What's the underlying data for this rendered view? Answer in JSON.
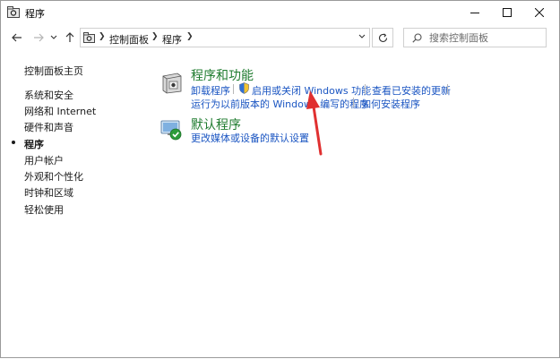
{
  "window": {
    "title": "程序",
    "minimize_icon": "minimize-icon",
    "maximize_icon": "maximize-icon",
    "close_icon": "close-icon"
  },
  "navigation": {
    "back_icon": "arrow-left-icon",
    "forward_icon": "arrow-right-icon",
    "recent_icon": "chevron-down-icon",
    "up_icon": "arrow-up-icon",
    "refresh_icon": "refresh-icon"
  },
  "address": {
    "crumbs": [
      "控制面板",
      "程序"
    ]
  },
  "search": {
    "placeholder": "搜索控制面板"
  },
  "sidebar": {
    "home": "控制面板主页",
    "items": [
      {
        "label": "系统和安全",
        "current": false
      },
      {
        "label": "网络和 Internet",
        "current": false
      },
      {
        "label": "硬件和声音",
        "current": false
      },
      {
        "label": "程序",
        "current": true
      },
      {
        "label": "用户帐户",
        "current": false
      },
      {
        "label": "外观和个性化",
        "current": false
      },
      {
        "label": "时钟和区域",
        "current": false
      },
      {
        "label": "轻松使用",
        "current": false
      }
    ]
  },
  "categories": [
    {
      "title": "程序和功能",
      "icon": "programs-features-icon",
      "links": [
        "卸载程序",
        "启用或关闭 Windows 功能",
        "查看已安装的更新",
        "运行为以前版本的 Windows 编写的程序",
        "如何安装程序"
      ]
    },
    {
      "title": "默认程序",
      "icon": "default-programs-icon",
      "links": [
        "更改媒体或设备的默认设置"
      ]
    }
  ],
  "colors": {
    "category_title": "#1e7b2e",
    "link": "#1a55c2",
    "annotation_arrow": "#e03030"
  }
}
